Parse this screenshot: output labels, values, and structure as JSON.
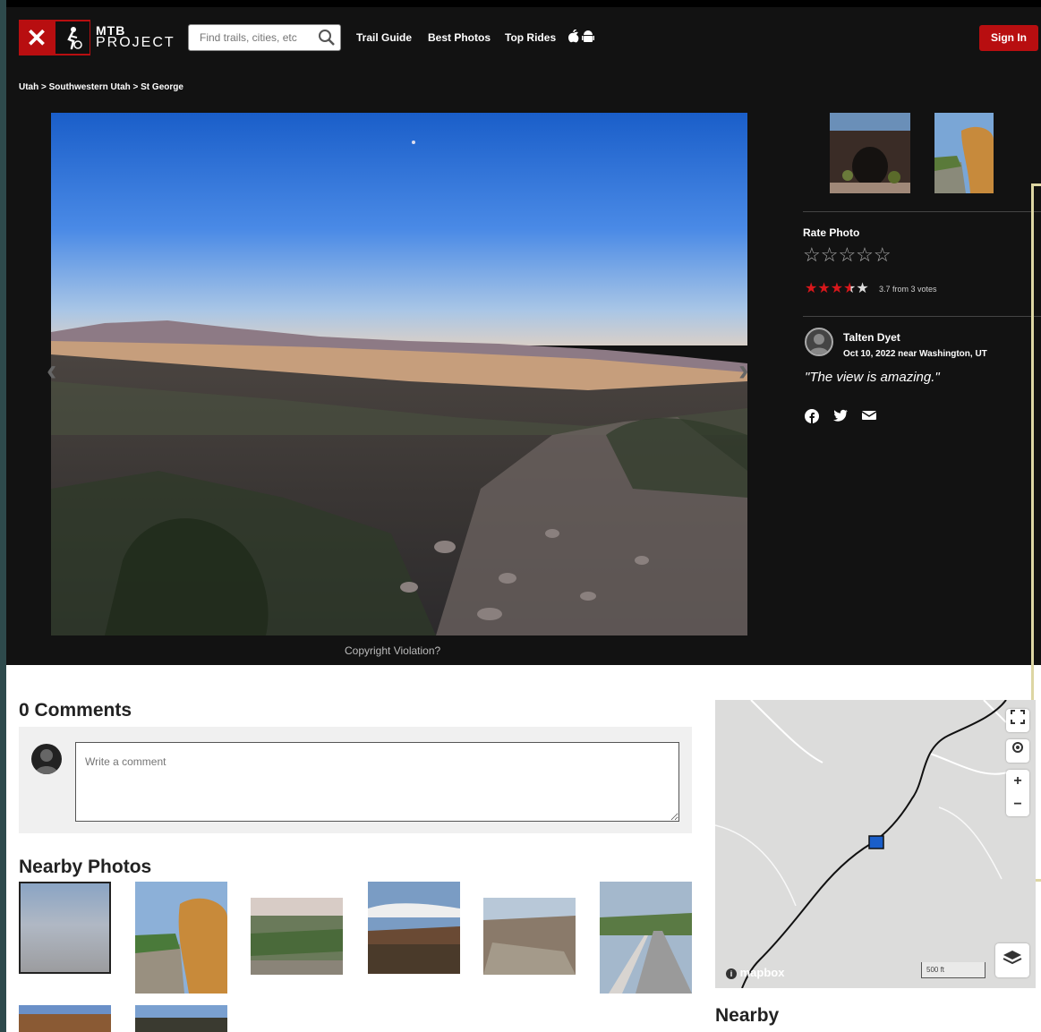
{
  "header": {
    "logo_line1": "MTB",
    "logo_line2": "PROJECT",
    "search_placeholder": "Find trails, cities, etc",
    "nav": [
      "Trail Guide",
      "Best Photos",
      "Top Rides"
    ],
    "signin_label": "Sign In"
  },
  "breadcrumb": "Utah > Southwestern Utah > St George",
  "photo": {
    "copyright_label": "Copyright Violation?"
  },
  "rating": {
    "label": "Rate Photo",
    "empty_stars": "☆☆☆☆☆",
    "average_stars": 3.7,
    "votes_text": "3.7 from 3 votes"
  },
  "author": {
    "name": "Talten Dyet",
    "date_location": "Oct 10, 2022 near Washington, UT",
    "quote": "\"The view is amazing.\""
  },
  "share_icons": [
    "facebook-icon",
    "twitter-icon",
    "email-icon"
  ],
  "comments": {
    "title": "0 Comments",
    "placeholder": "Write a comment"
  },
  "nearby_photos": {
    "title": "Nearby Photos"
  },
  "map": {
    "attribution": "mapbox",
    "scale": "500 ft",
    "zoom_in": "+",
    "zoom_out": "−"
  },
  "nearby": {
    "title": "Nearby"
  },
  "colors": {
    "brand_red": "#b80e10",
    "dark_bg": "#121212",
    "star_red": "#d8171b"
  }
}
